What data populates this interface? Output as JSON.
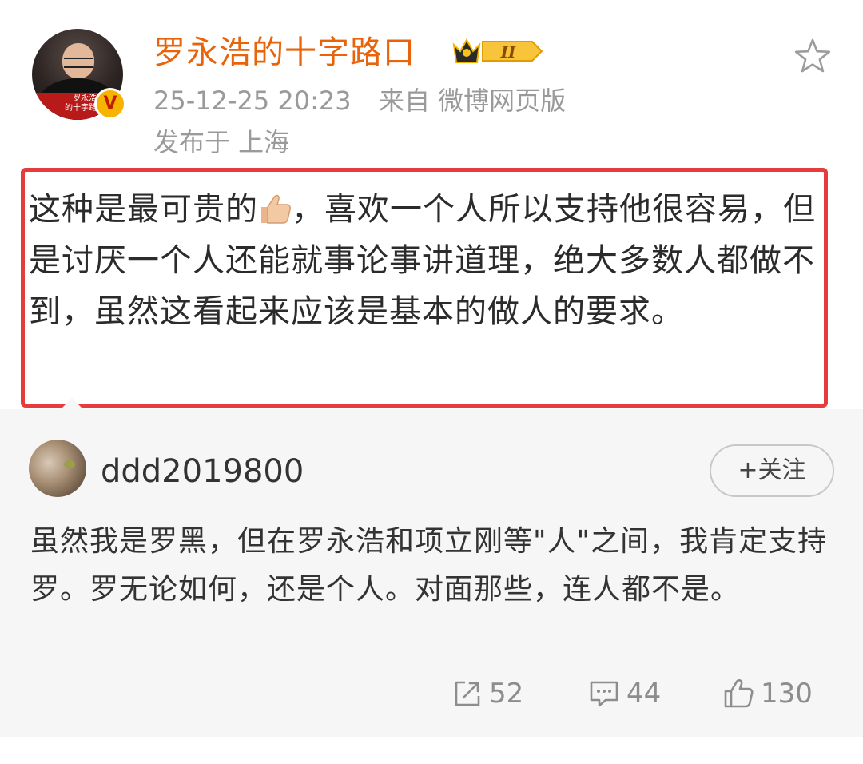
{
  "author": {
    "name": "罗永浩的十字路口",
    "avatar_caption": "罗永浩\n的十字路口",
    "verified_mark": "V",
    "level_badge": "II",
    "timestamp": "25-12-25 20:23",
    "source": "来自 微博网页版",
    "location": "发布于 上海"
  },
  "post": {
    "text_before_emoji": "这种是最可贵的",
    "text_after_emoji": "，喜欢一个人所以支持他很容易，但是讨厌一个人还能就事论事讲道理，绝大多数人都做不到，虽然这看起来应该是基本的做人的要求。",
    "highlight_color": "#e63c3c"
  },
  "comment": {
    "user": "ddd2019800",
    "follow_label": "+关注",
    "text": "虽然我是罗黑，但在罗永浩和项立刚等\"人\"之间，我肯定支持罗。罗无论如何，还是个人。对面那些，连人都不是。"
  },
  "actions": {
    "repost_count": "52",
    "comment_count": "44",
    "like_count": "130"
  },
  "icons": {
    "favorite": "star-icon",
    "repost": "repost-icon",
    "comment": "comment-icon",
    "like": "thumbs-up-icon",
    "emoji": "thumbs-up-emoji"
  },
  "colors": {
    "username": "#e8630a",
    "meta": "#9a9a9a",
    "comment_bg": "#f6f6f6"
  }
}
